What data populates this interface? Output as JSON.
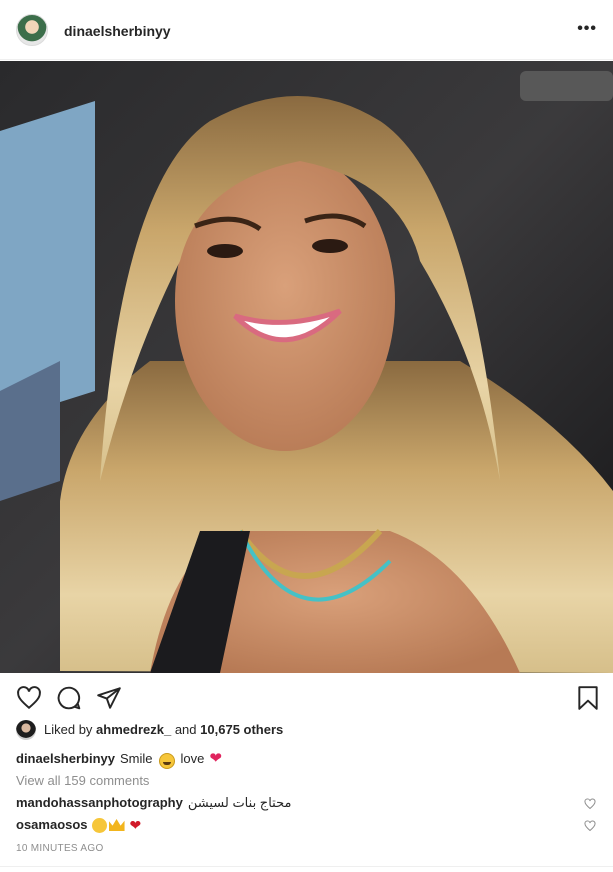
{
  "header": {
    "username": "dinaelsherbinyy",
    "more_label": "•••"
  },
  "photo": {
    "alt": "selfie in car"
  },
  "actions": {
    "icons": [
      "heart-icon",
      "comment-icon",
      "share-icon",
      "bookmark-icon"
    ]
  },
  "likes": {
    "prefix": "Liked by",
    "liker": "ahmedrezk_",
    "and": "and",
    "count": "10,675 others"
  },
  "caption": {
    "username": "dinaelsherbinyy",
    "text_1": "Smile",
    "text_2": "love"
  },
  "comments": {
    "view_all": "View all 159 comments",
    "items": [
      {
        "username": "mandohassanphotography",
        "text": "محتاج بنات لسيشن"
      },
      {
        "username": "osamaosos",
        "text": ""
      }
    ]
  },
  "timestamp": "10 MINUTES AGO",
  "colors": {
    "text": "#262626",
    "muted": "#8e8e8e",
    "heart": "#e0245e"
  }
}
